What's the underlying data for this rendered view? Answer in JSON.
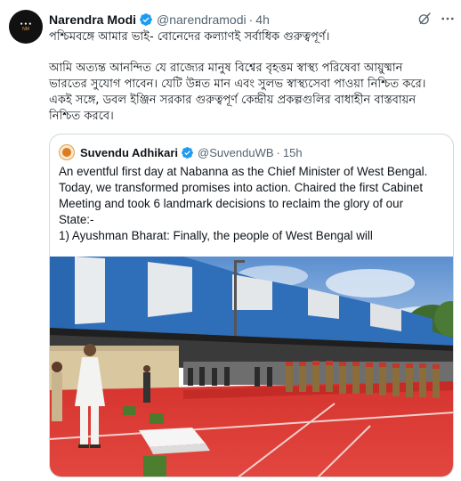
{
  "post": {
    "author_name": "Narendra Modi",
    "author_handle": "@narendramodi",
    "dot": "·",
    "time": "4h",
    "avatar_text": [
      "● ● ●",
      "NM"
    ],
    "text_line1": "পশ্চিমবঙ্গে আমার ভাই- বোনেদের কল্যাণই সর্বাধিক গুরুত্বপূর্ণ।",
    "paragraph_lines": [
      "আমি অত্যন্ত আনন্দিত যে রাজ্যের মানুষ বিশ্বের বৃহত্তম স্বাস্থ্য পরিষেবা আয়ুষ্মান",
      "ভারতের সুযোগ পাবেন। যেটি উন্নত মান এবং সুলভ স্বাস্থ্যসেবা পাওয়া নিশ্চিত করে।",
      "একই সঙ্গে, ডবল ইঞ্জিন সরকার গুরুত্বপূর্ণ কেন্দ্রীয় প্রকল্পগুলির  বাধাহীন বাস্তবায়ন",
      "নিশ্চিত করবে।"
    ],
    "icons": {
      "verified": "verified-badge-icon",
      "grok": "grok-icon",
      "more": "more-options-icon"
    }
  },
  "quote": {
    "author_name": "Suvendu Adhikari",
    "author_handle": "@SuvenduWB",
    "dot": "·",
    "time": "15h",
    "text_lines": [
      "An eventful first day at Nabanna as the Chief Minister of West Bengal.",
      "Today, we transformed promises into action. Chaired the first Cabinet",
      "Meeting and took 6 landmark decisions to reclaim the glory of our",
      "State:-",
      "1) Ayushman Bharat: Finally, the people of West Bengal will"
    ],
    "media": "photo: man in white kurta standing on red carpet before a guard of honour outside a building with blue and white stripes"
  },
  "colors": {
    "verified": "#1d9bf0",
    "text": "#0f1419",
    "muted": "#536471",
    "border": "#cfd9de"
  }
}
